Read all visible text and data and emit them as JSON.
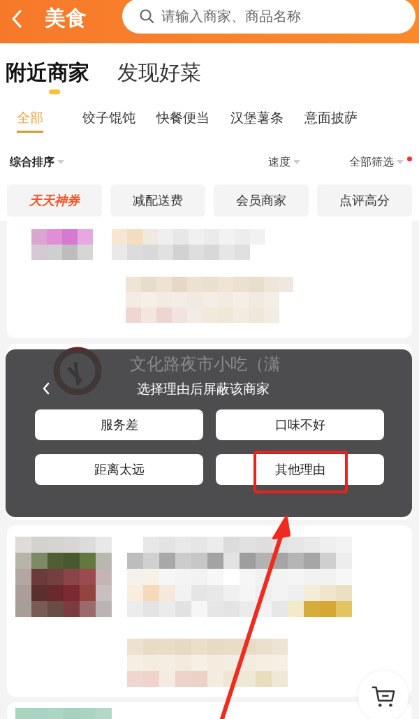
{
  "header": {
    "title": "美食",
    "search": {
      "placeholder": "请输入商家、商品名称"
    }
  },
  "main_tabs": [
    {
      "label": "附近商家",
      "selected": true
    },
    {
      "label": "发现好菜",
      "selected": false
    }
  ],
  "categories": [
    {
      "label": "全部",
      "selected": true
    },
    {
      "label": "饺子馄饨",
      "selected": false
    },
    {
      "label": "快餐便当",
      "selected": false
    },
    {
      "label": "汉堡薯条",
      "selected": false
    },
    {
      "label": "意面披萨",
      "selected": false
    }
  ],
  "sort_options": [
    {
      "label": "综合排序",
      "bold": true,
      "dot": false
    },
    {
      "label": "速度",
      "bold": false,
      "dot": false
    },
    {
      "label": "全部筛选",
      "bold": false,
      "dot": true
    }
  ],
  "chips": [
    {
      "label": "天天神券",
      "kind": "promo"
    },
    {
      "label": "减配送费",
      "kind": "plain"
    },
    {
      "label": "会员商家",
      "kind": "plain"
    },
    {
      "label": "点评高分",
      "kind": "plain"
    }
  ],
  "store_under_dialog": {
    "name": "文化路夜市小吃（潇"
  },
  "block_dialog": {
    "title": "选择理由后屏蔽该商家",
    "reasons": [
      {
        "label": "服务差",
        "highlighted": false
      },
      {
        "label": "口味不好",
        "highlighted": false
      },
      {
        "label": "距离太远",
        "highlighted": false
      },
      {
        "label": "其他理由",
        "highlighted": true
      }
    ]
  }
}
